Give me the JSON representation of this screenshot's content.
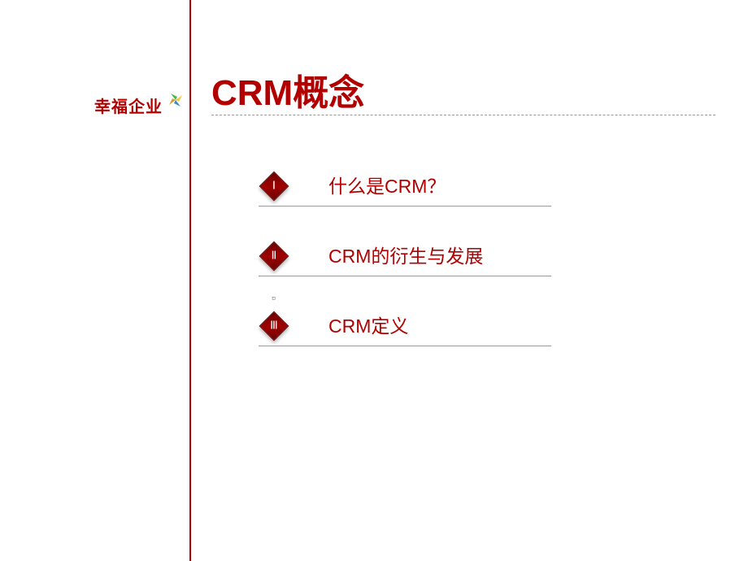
{
  "logo": {
    "text": "幸福企业"
  },
  "title": "CRM概念",
  "toc": [
    {
      "number": "Ⅰ",
      "label": "什么是CRM？"
    },
    {
      "number": "Ⅱ",
      "label": "CRM的衍生与发展"
    },
    {
      "number": "Ⅲ",
      "label": "CRM定义"
    }
  ],
  "centerMark": "▫"
}
